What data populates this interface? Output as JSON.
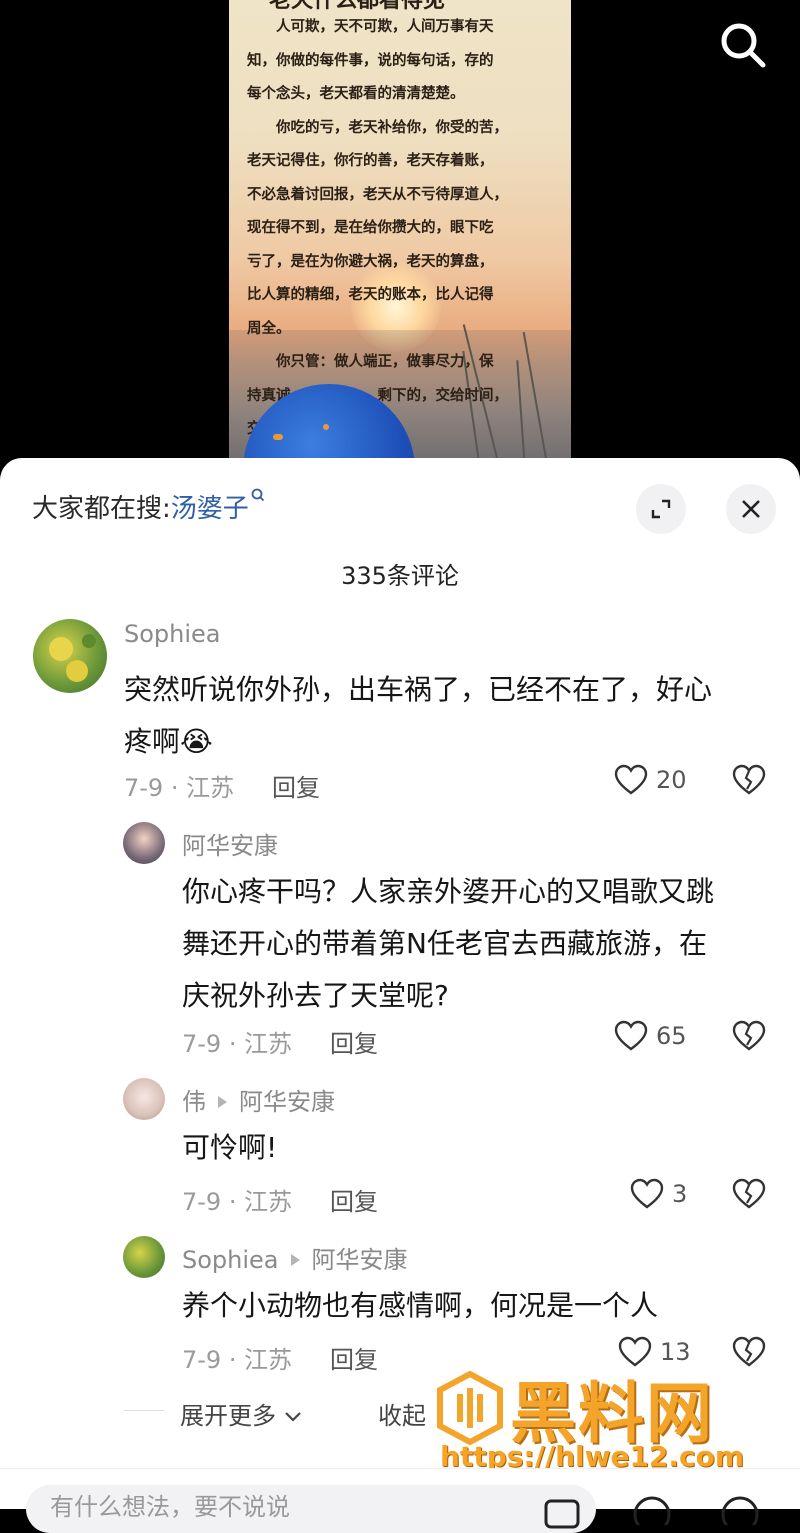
{
  "poster": {
    "title": "老天什么都看得见",
    "lines": [
      "　　人可欺，天不可欺，人间万事有天",
      "知，你做的每件事，说的每句话，存的",
      "每个念头，老天都看的清清楚楚。",
      "　　你吃的亏，老天补给你，你受的苦，",
      "老天记得住，你行的善，老天存着账，",
      "不必急着讨回报，老天从不亏待厚道人，",
      "现在得不到，是在给你攒大的，眼下吃",
      "亏了，是在为你避大祸，老天的算盘，",
      "比人算的精细，老天的账本，比人记得",
      "周全。",
      "　　你只管：做人端正，做事尽力，保",
      "持真诚，守住良心，剩下的，交给时间，",
      "交给老天。"
    ]
  },
  "header": {
    "trend_prefix": "大家都在搜:",
    "trend_keyword": "汤婆子",
    "comment_count": "335条评论"
  },
  "comments": [
    {
      "user": "Sophiea",
      "text_line1": "突然听说你外孙，出车祸了，已经不在了，好心",
      "text_line2": "疼啊",
      "emoji": "😭",
      "meta": "7-9 · 江苏",
      "reply_label": "回复",
      "likes": "20"
    },
    {
      "user": "阿华安康",
      "text_line1": "你心疼干吗？人家亲外婆开心的又唱歌又跳",
      "text_line2": "舞还开心的带着第N任老官去西藏旅游，在",
      "text_line3": "庆祝外孙去了天堂呢?",
      "meta": "7-9 · 江苏",
      "reply_label": "回复",
      "likes": "65"
    },
    {
      "user": "伟",
      "reply_to": "阿华安康",
      "text_line1": "可怜啊!",
      "meta": "7-9 · 江苏",
      "reply_label": "回复",
      "likes": "3"
    },
    {
      "user": "Sophiea",
      "reply_to": "阿华安康",
      "text_line1": "养个小动物也有感情啊，何况是一个人",
      "meta": "7-9 · 江苏",
      "reply_label": "回复",
      "likes": "13"
    }
  ],
  "thread": {
    "expand_label": "展开更多",
    "collapse_label": "收起"
  },
  "watermark": {
    "text": "黑料网",
    "url": "https://hlwe12.com"
  },
  "input": {
    "placeholder": "有什么想法，要不说说"
  },
  "icons": [
    "search-icon",
    "fullscreen-icon",
    "close-icon",
    "heart-icon",
    "broken-heart-icon",
    "chevron-down-icon"
  ]
}
